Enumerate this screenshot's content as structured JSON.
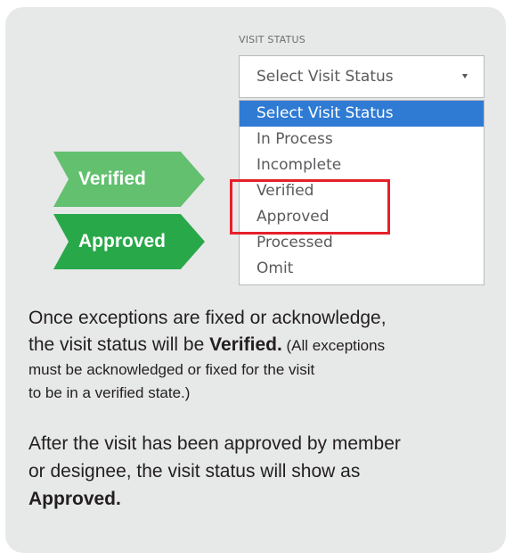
{
  "visit_status": {
    "label": "VISIT STATUS",
    "selected_value": "Select Visit Status",
    "options": [
      "Select Visit Status",
      "In Process",
      "Incomplete",
      "Verified",
      "Approved",
      "Processed",
      "Omit"
    ],
    "highlighted_options": [
      "Verified",
      "Approved"
    ]
  },
  "arrows": {
    "verified": "Verified",
    "approved": "Approved"
  },
  "paragraph1": {
    "line1": "Once exceptions are fixed or acknowledge,",
    "line2_prefix": "the visit status will be ",
    "line2_bold": "Verified.",
    "line2_suffix": " (All exceptions",
    "line3": "must be acknowledged or fixed for the visit",
    "line4": "to be in a verified state.)"
  },
  "paragraph2": {
    "line1": "After the visit has been approved by member",
    "line2": "or designee, the visit status will show as",
    "line3_bold": "Approved."
  },
  "colors": {
    "card_background": "#e7e8e8",
    "selected_option": "#2f7bd4",
    "highlight_border": "#e5202b",
    "arrow_verified": "#62c06f",
    "arrow_approved": "#29a84a"
  }
}
